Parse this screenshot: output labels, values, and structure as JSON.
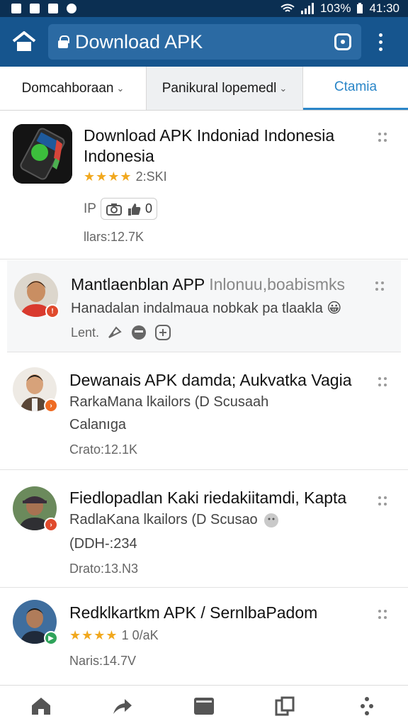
{
  "status_bar": {
    "battery": "103%",
    "time": "41:30"
  },
  "address_bar": {
    "title": "Download APK"
  },
  "filters": [
    {
      "label": "Domcahboraan"
    },
    {
      "label": "Panikural lopemedl"
    },
    {
      "label": "Ctamia"
    }
  ],
  "feed": [
    {
      "title_line1": "Download APK Indoniad Indonesia",
      "title_line2": "Indonesia",
      "rating_stars": "★★★★",
      "rating_count": "2:SKI",
      "tags": "IP",
      "tag_count": "0",
      "stats": "llars:12.7K"
    },
    {
      "title": "Mantlaenblan APP",
      "title_suffix": "Inlonuu,boabismks",
      "subtitle": "Hanadalan indalmaua nobkak pa tlaakla",
      "emoji": "😀",
      "meta": "Lent."
    },
    {
      "title": "Dewanais APK damda; Aukvatka Vagia",
      "subtitle": "RarkaMana lkailors (D Scusaah",
      "line3": "Calanıga",
      "stats": "Crato:12.1K"
    },
    {
      "title": "Fiedlopadlan Kaki riedakiitamdi, Kapta",
      "subtitle": "RadlaKana lkailors (D Scusao",
      "line3": "(DDH-:234",
      "stats": "Drato:13.N3"
    },
    {
      "title": "Redklkartkm APK / SernlbaPadom",
      "rating_stars": "★★★★",
      "rating_count": "1 0/aK",
      "stats": "Naris:14.7V"
    }
  ],
  "colors": {
    "app_bar": "#16558e",
    "status_bar": "#0b2f52",
    "accent": "#2a86c8",
    "star": "#f1a81e"
  },
  "icons": [
    "home-icon",
    "lock-icon",
    "tabs-icon",
    "more-vert-icon",
    "share-icon",
    "card-icon",
    "bookmark-icon",
    "grid-dots-icon"
  ]
}
